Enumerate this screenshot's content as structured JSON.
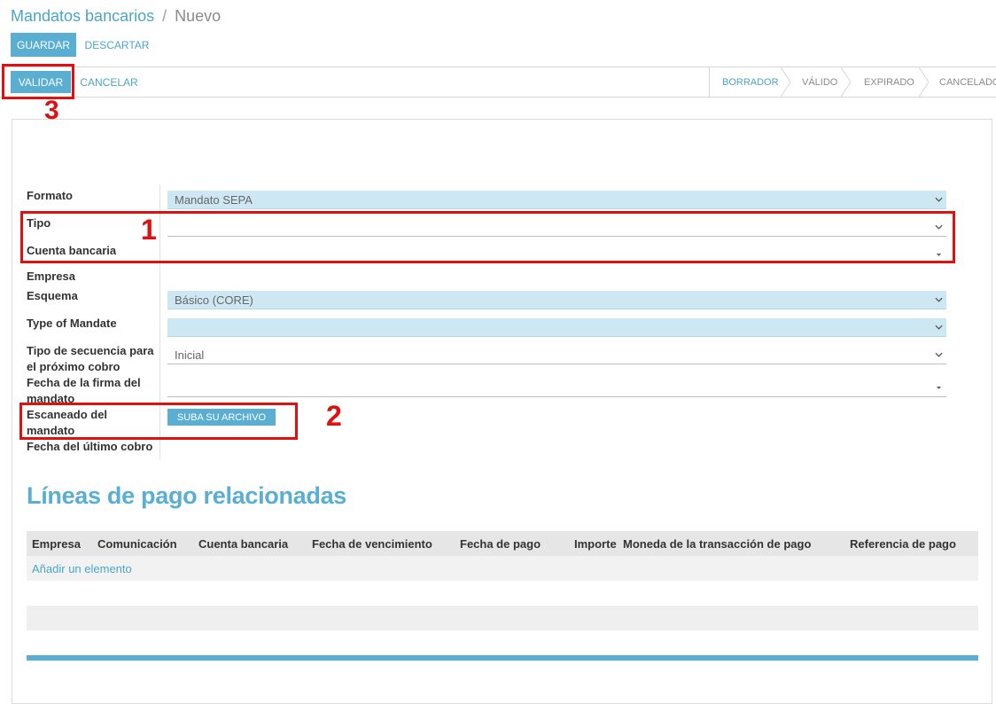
{
  "breadcrumb": {
    "parent": "Mandatos bancarios",
    "separator": "/",
    "current": "Nuevo"
  },
  "toolbar": {
    "save_label": "GUARDAR",
    "discard_label": "DESCARTAR"
  },
  "statusbar": {
    "validate_label": "VALIDAR",
    "cancel_label": "CANCELAR",
    "stages": [
      {
        "label": "BORRADOR",
        "active": true
      },
      {
        "label": "VÁLIDO",
        "active": false
      },
      {
        "label": "EXPIRADO",
        "active": false
      },
      {
        "label": "CANCELADO",
        "active": false
      }
    ]
  },
  "form": {
    "formato": {
      "label": "Formato",
      "value": "Mandato SEPA"
    },
    "tipo": {
      "label": "Tipo",
      "value": ""
    },
    "cuenta_bancaria": {
      "label": "Cuenta bancaria",
      "value": ""
    },
    "empresa": {
      "label": "Empresa"
    },
    "esquema": {
      "label": "Esquema",
      "value": "Básico (CORE)"
    },
    "type_of_mandate": {
      "label": "Type of Mandate",
      "value": ""
    },
    "tipo_secuencia": {
      "label_line1": "Tipo de secuencia para",
      "label_line2": "el próximo cobro",
      "value": "Inicial"
    },
    "fecha_firma": {
      "label_line1": "Fecha de la firma del",
      "label_line2": "mandato",
      "value": ""
    },
    "escaneado": {
      "label_line1": "Escaneado del",
      "label_line2": "mandato",
      "upload_label": "SUBA SU ARCHIVO"
    },
    "fecha_ultimo_cobro": {
      "label": "Fecha del último cobro"
    }
  },
  "payment_lines": {
    "title": "Líneas de pago relacionadas",
    "columns": [
      "Empresa",
      "Comunicación",
      "Cuenta bancaria",
      "Fecha de vencimiento",
      "Fecha de pago",
      "Importe",
      "Moneda de la transacción de pago",
      "Referencia de pago"
    ],
    "add_item_label": "Añadir un elemento"
  },
  "annotations": [
    "1",
    "2",
    "3"
  ],
  "colors": {
    "accent": "#5aaed1",
    "required_bg": "#cde8f3",
    "annotation": "#e01010"
  }
}
